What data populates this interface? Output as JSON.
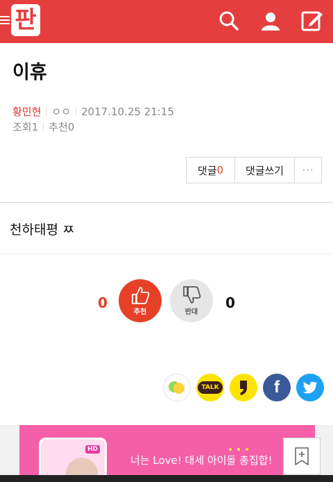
{
  "header": {
    "logo_text": "판",
    "background_color": "#e53e3e",
    "icons": [
      "menu-icon",
      "search-icon",
      "user-icon",
      "write-icon"
    ]
  },
  "post": {
    "title": "이휴",
    "author": "황민현",
    "extra": "ㅇㅇ",
    "datetime": "2017.10.25 21:15",
    "views_label": "조회",
    "views": "1",
    "recommend_label": "추천",
    "recommend": "0",
    "content": "천하태평 ㅉ"
  },
  "actions": {
    "comments_label": "댓글",
    "comments_count": "0",
    "write_comment_label": "댓글쓰기",
    "more_label": "···"
  },
  "vote": {
    "up_count": "0",
    "up_label": "추천",
    "down_count": "0",
    "down_label": "반대",
    "up_color": "#e64028"
  },
  "share": {
    "icons": [
      "kakaostory-icon",
      "kakaotalk-icon",
      "kakaostory-quote-icon",
      "facebook-icon",
      "twitter-icon"
    ],
    "talk_label": "TALK",
    "facebook_label": "f"
  },
  "ad": {
    "text": "너는 Love! 대세 아이돌 총집합!",
    "badge": "HD"
  },
  "bookmark": {
    "icon": "bookmark-add-icon"
  }
}
